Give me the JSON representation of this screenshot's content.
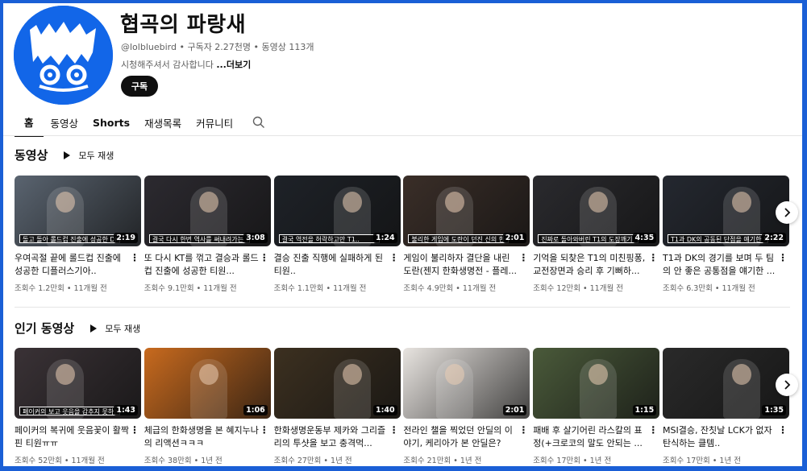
{
  "channel": {
    "name": "협곡의 파랑새",
    "meta": "@lolbluebird • 구독자 2.27천명 • 동영상 113개",
    "description": "시청해주셔서 감사합니다",
    "more_label": "...더보기",
    "subscribe_label": "구독"
  },
  "tabs": [
    {
      "label": "홈"
    },
    {
      "label": "동영상"
    },
    {
      "label": "Shorts"
    },
    {
      "label": "재생목록"
    },
    {
      "label": "커뮤니티"
    }
  ],
  "sections": [
    {
      "title": "동영상",
      "play_all": "모두 재생",
      "videos": [
        {
          "caption": "돌고 돌아 롤드컵 진출에 성공한 DK",
          "duration": "2:19",
          "title": "우여곡절 끝에 롤드컵 진출에 성공한 디플러스기아..",
          "meta": "조회수 1.2만회 • 11개월 전",
          "color": "#5a6470"
        },
        {
          "caption": "결국 다시 한번 역사를 써내려가는 T1",
          "duration": "3:08",
          "title": "또 다시 KT를 꺾고 결승과 롤드컵 진출에 성공한 티원...",
          "meta": "조회수 9.1만회 • 11개월 전",
          "color": "#2c2a30"
        },
        {
          "caption": "결국 역전을 허락하고만 T1..",
          "duration": "1:24",
          "title": "결승 진출 직행에 실패하게 된 티원..",
          "meta": "조회수 1.1만회 • 11개월 전",
          "color": "#1e2228"
        },
        {
          "caption": "불리한 게임에 도란이 던진 신의 한 수",
          "duration": "2:01",
          "title": "게임이 불리하자 결단을 내린 도란(젠지 한화생명전 - 플레...",
          "meta": "조회수 4.9만회 • 11개월 전",
          "color": "#3a2e28"
        },
        {
          "caption": "진짜로 돌아와버린 T1의 도장깨기",
          "duration": "4:35",
          "title": "기억을 되찾은 T1의 미친핑퐁, 교전장면과 승리 후 기뻐하...",
          "meta": "조회수 12만회 • 11개월 전",
          "color": "#2a2a2e"
        },
        {
          "caption": "T1과 DK의 공동된 단점을 얘기한 페이커",
          "duration": "2:22",
          "title": "T1과 DK의 경기를 보며 두 팀의 안 좋은 공통점을 얘기한 ...",
          "meta": "조회수 6.3만회 • 11개월 전",
          "color": "#242830"
        }
      ]
    },
    {
      "title": "인기 동영상",
      "play_all": "모두 재생",
      "videos": [
        {
          "caption": "페이커의 보고 웃음을 감추지 못하는",
          "duration": "1:43",
          "title": "페이커의 복귀에 웃음꽃이 활짝 핀 티원ㅠㅠ",
          "meta": "조회수 52만회 • 11개월 전",
          "color": "#3a3236"
        },
        {
          "caption": "",
          "duration": "1:06",
          "title": "체급의 한화생명을 본 혜지누나의 리액션ㅋㅋㅋ",
          "meta": "조회수 38만회 • 1년 전",
          "color": "#c86a1e"
        },
        {
          "caption": "",
          "duration": "1:40",
          "title": "한화생명운동부 제카와 그리즐리의 투샷을 보고 충격먹...",
          "meta": "조회수 27만회 • 1년 전",
          "color": "#3c3020"
        },
        {
          "caption": "",
          "duration": "2:01",
          "title": "전라인 챌을 찍었던 안딜의 이야기, 케리아가 본 안딜은?",
          "meta": "조회수 21만회 • 1년 전",
          "color": "#e8e4e0"
        },
        {
          "caption": "",
          "duration": "1:15",
          "title": "패배 후 살기어린 라스칼의 표정(+크로코의 말도 안되는 ...",
          "meta": "조회수 17만회 • 1년 전",
          "color": "#4a5a3a"
        },
        {
          "caption": "",
          "duration": "1:35",
          "title": "MSI결승, 잔칫날 LCK가 없자 탄식하는 클템..",
          "meta": "조회수 17만회 • 1년 전",
          "color": "#2a2a2a"
        }
      ]
    }
  ]
}
